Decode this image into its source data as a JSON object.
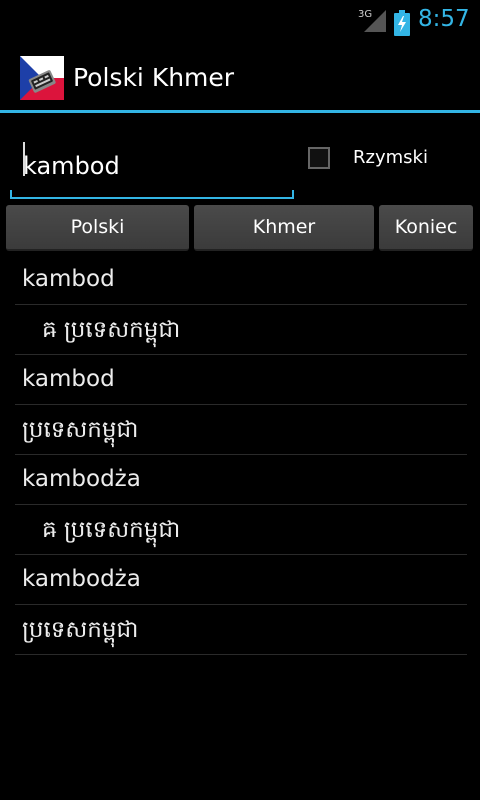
{
  "status_bar": {
    "network_type": "3G",
    "time": "8:57",
    "signal_icon": "signal-icon",
    "battery_icon": "battery-charging-icon",
    "clock_color": "#33b5e5"
  },
  "action_bar": {
    "title": "Polski Khmer",
    "app_icon": "flag-keyboard-app-icon",
    "accent_color": "#33b5e5"
  },
  "search": {
    "value": "kambod",
    "placeholder": ""
  },
  "romanized_option": {
    "label": "Rzymski",
    "checked": false
  },
  "buttons": {
    "polski": "Polski",
    "khmer": "Khmer",
    "koniec": "Koniec"
  },
  "results": [
    {
      "text": "kambod",
      "script": "latin",
      "indent": false
    },
    {
      "text": "ឝ ប្រទេសកម្ពុជា",
      "script": "khmer",
      "indent": true
    },
    {
      "text": "kambod",
      "script": "latin",
      "indent": false
    },
    {
      "text": "ប្រទេសកម្ពុជា",
      "script": "khmer",
      "indent": false
    },
    {
      "text": "kambodża",
      "script": "latin",
      "indent": false
    },
    {
      "text": "ឝ ប្រទេសកម្ពុជា",
      "script": "khmer",
      "indent": true
    },
    {
      "text": "kambodża",
      "script": "latin",
      "indent": false
    },
    {
      "text": "ប្រទេសកម្ពុជា",
      "script": "khmer",
      "indent": false
    }
  ]
}
